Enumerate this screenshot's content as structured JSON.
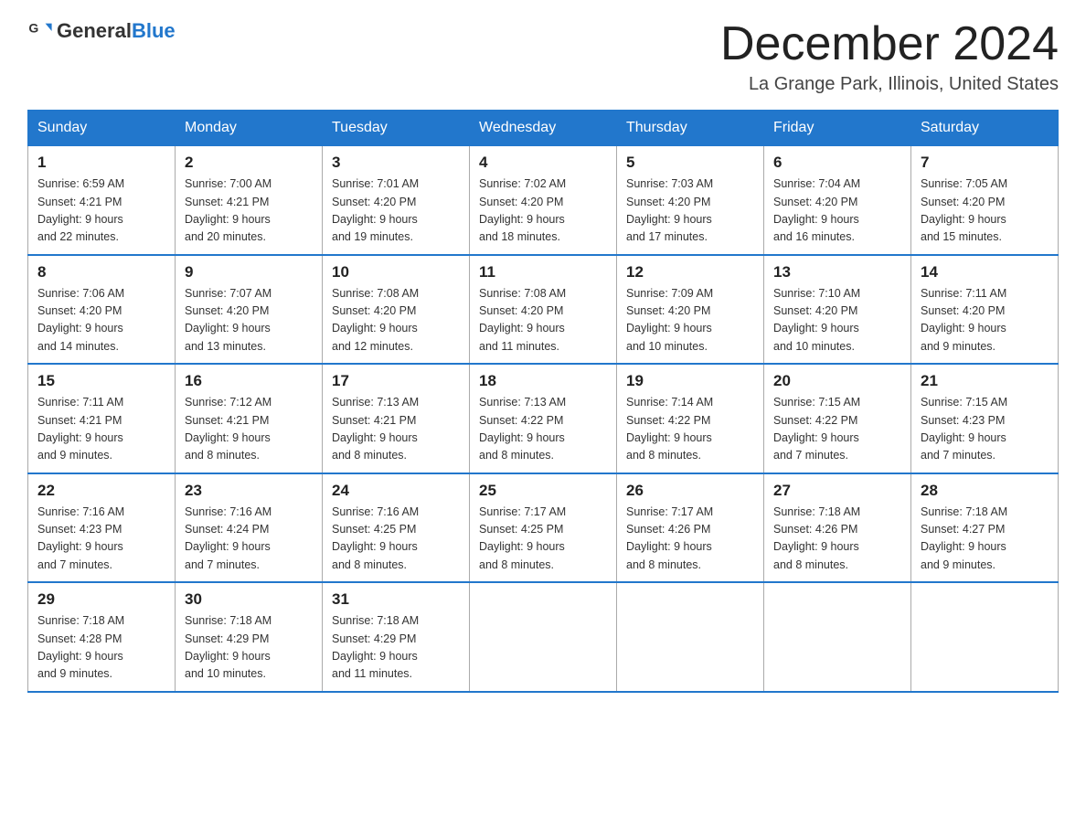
{
  "header": {
    "logo_general": "General",
    "logo_blue": "Blue",
    "month_title": "December 2024",
    "location": "La Grange Park, Illinois, United States"
  },
  "weekdays": [
    "Sunday",
    "Monday",
    "Tuesday",
    "Wednesday",
    "Thursday",
    "Friday",
    "Saturday"
  ],
  "weeks": [
    [
      {
        "day": "1",
        "sunrise": "6:59 AM",
        "sunset": "4:21 PM",
        "daylight": "9 hours and 22 minutes."
      },
      {
        "day": "2",
        "sunrise": "7:00 AM",
        "sunset": "4:21 PM",
        "daylight": "9 hours and 20 minutes."
      },
      {
        "day": "3",
        "sunrise": "7:01 AM",
        "sunset": "4:20 PM",
        "daylight": "9 hours and 19 minutes."
      },
      {
        "day": "4",
        "sunrise": "7:02 AM",
        "sunset": "4:20 PM",
        "daylight": "9 hours and 18 minutes."
      },
      {
        "day": "5",
        "sunrise": "7:03 AM",
        "sunset": "4:20 PM",
        "daylight": "9 hours and 17 minutes."
      },
      {
        "day": "6",
        "sunrise": "7:04 AM",
        "sunset": "4:20 PM",
        "daylight": "9 hours and 16 minutes."
      },
      {
        "day": "7",
        "sunrise": "7:05 AM",
        "sunset": "4:20 PM",
        "daylight": "9 hours and 15 minutes."
      }
    ],
    [
      {
        "day": "8",
        "sunrise": "7:06 AM",
        "sunset": "4:20 PM",
        "daylight": "9 hours and 14 minutes."
      },
      {
        "day": "9",
        "sunrise": "7:07 AM",
        "sunset": "4:20 PM",
        "daylight": "9 hours and 13 minutes."
      },
      {
        "day": "10",
        "sunrise": "7:08 AM",
        "sunset": "4:20 PM",
        "daylight": "9 hours and 12 minutes."
      },
      {
        "day": "11",
        "sunrise": "7:08 AM",
        "sunset": "4:20 PM",
        "daylight": "9 hours and 11 minutes."
      },
      {
        "day": "12",
        "sunrise": "7:09 AM",
        "sunset": "4:20 PM",
        "daylight": "9 hours and 10 minutes."
      },
      {
        "day": "13",
        "sunrise": "7:10 AM",
        "sunset": "4:20 PM",
        "daylight": "9 hours and 10 minutes."
      },
      {
        "day": "14",
        "sunrise": "7:11 AM",
        "sunset": "4:20 PM",
        "daylight": "9 hours and 9 minutes."
      }
    ],
    [
      {
        "day": "15",
        "sunrise": "7:11 AM",
        "sunset": "4:21 PM",
        "daylight": "9 hours and 9 minutes."
      },
      {
        "day": "16",
        "sunrise": "7:12 AM",
        "sunset": "4:21 PM",
        "daylight": "9 hours and 8 minutes."
      },
      {
        "day": "17",
        "sunrise": "7:13 AM",
        "sunset": "4:21 PM",
        "daylight": "9 hours and 8 minutes."
      },
      {
        "day": "18",
        "sunrise": "7:13 AM",
        "sunset": "4:22 PM",
        "daylight": "9 hours and 8 minutes."
      },
      {
        "day": "19",
        "sunrise": "7:14 AM",
        "sunset": "4:22 PM",
        "daylight": "9 hours and 8 minutes."
      },
      {
        "day": "20",
        "sunrise": "7:15 AM",
        "sunset": "4:22 PM",
        "daylight": "9 hours and 7 minutes."
      },
      {
        "day": "21",
        "sunrise": "7:15 AM",
        "sunset": "4:23 PM",
        "daylight": "9 hours and 7 minutes."
      }
    ],
    [
      {
        "day": "22",
        "sunrise": "7:16 AM",
        "sunset": "4:23 PM",
        "daylight": "9 hours and 7 minutes."
      },
      {
        "day": "23",
        "sunrise": "7:16 AM",
        "sunset": "4:24 PM",
        "daylight": "9 hours and 7 minutes."
      },
      {
        "day": "24",
        "sunrise": "7:16 AM",
        "sunset": "4:25 PM",
        "daylight": "9 hours and 8 minutes."
      },
      {
        "day": "25",
        "sunrise": "7:17 AM",
        "sunset": "4:25 PM",
        "daylight": "9 hours and 8 minutes."
      },
      {
        "day": "26",
        "sunrise": "7:17 AM",
        "sunset": "4:26 PM",
        "daylight": "9 hours and 8 minutes."
      },
      {
        "day": "27",
        "sunrise": "7:18 AM",
        "sunset": "4:26 PM",
        "daylight": "9 hours and 8 minutes."
      },
      {
        "day": "28",
        "sunrise": "7:18 AM",
        "sunset": "4:27 PM",
        "daylight": "9 hours and 9 minutes."
      }
    ],
    [
      {
        "day": "29",
        "sunrise": "7:18 AM",
        "sunset": "4:28 PM",
        "daylight": "9 hours and 9 minutes."
      },
      {
        "day": "30",
        "sunrise": "7:18 AM",
        "sunset": "4:29 PM",
        "daylight": "9 hours and 10 minutes."
      },
      {
        "day": "31",
        "sunrise": "7:18 AM",
        "sunset": "4:29 PM",
        "daylight": "9 hours and 11 minutes."
      },
      null,
      null,
      null,
      null
    ]
  ],
  "labels": {
    "sunrise": "Sunrise:",
    "sunset": "Sunset:",
    "daylight": "Daylight:"
  }
}
